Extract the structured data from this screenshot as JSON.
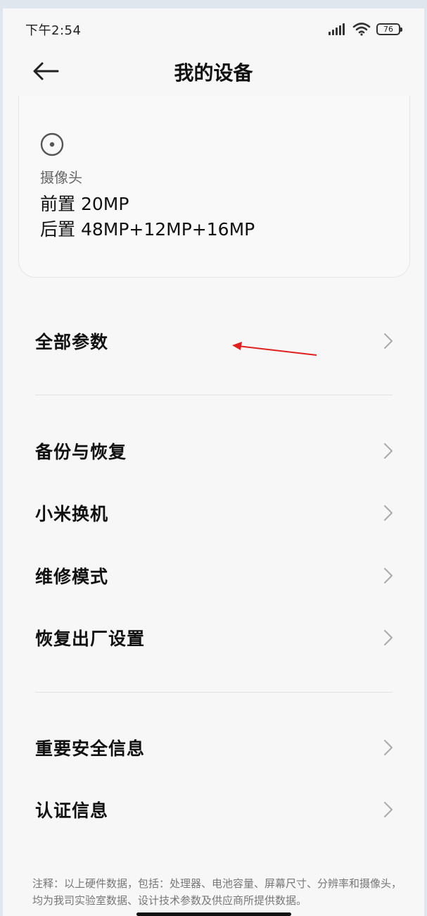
{
  "status_bar": {
    "time": "下午2:54",
    "battery": "76"
  },
  "header": {
    "title": "我的设备",
    "back_icon": "arrow-left-icon"
  },
  "camera_card": {
    "icon": "camera-lens-icon",
    "label": "摄像头",
    "front": "前置 20MP",
    "rear": "后置 48MP+12MP+16MP"
  },
  "sections": {
    "all_params": "全部参数",
    "backup_restore": "备份与恢复",
    "mi_mover": "小米换机",
    "repair_mode": "维修模式",
    "factory_reset": "恢复出厂设置",
    "safety_info": "重要安全信息",
    "certification": "认证信息"
  },
  "annotation": {
    "arrow_color": "#e02020"
  },
  "footnote": "注释：以上硬件数据，包括：处理器、电池容量、屏幕尺寸、分辨率和摄像头，均为我司实验室数据、设计技术参数及供应商所提供数据。"
}
